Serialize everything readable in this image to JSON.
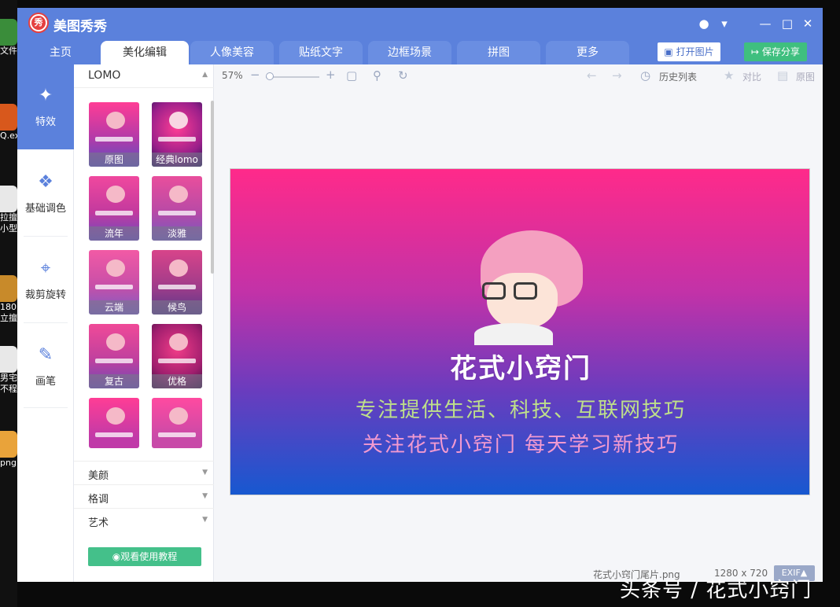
{
  "app": {
    "title": "美图秀秀",
    "logo_text": "秀"
  },
  "desktop": {
    "labels": [
      "文件",
      "Q.exe",
      "拉擅",
      "小型",
      "180",
      "立擅",
      "男宅",
      "不程",
      "png"
    ]
  },
  "titlebar_controls": [
    "comment-icon",
    "dropdown-icon",
    "minimize-icon",
    "maximize-icon",
    "close-icon"
  ],
  "tabs": [
    {
      "label": "主页",
      "active": false
    },
    {
      "label": "美化编辑",
      "active": true
    },
    {
      "label": "人像美容",
      "active": false
    },
    {
      "label": "贴纸文字",
      "active": false
    },
    {
      "label": "边框场景",
      "active": false
    },
    {
      "label": "拼图",
      "active": false
    },
    {
      "label": "更多",
      "active": false
    }
  ],
  "header_buttons": {
    "open": "打开图片",
    "save": "保存分享"
  },
  "nav": [
    {
      "label": "特效",
      "icon": "magic-wand-icon",
      "selected": true
    },
    {
      "label": "基础调色",
      "icon": "palette-icon",
      "selected": false
    },
    {
      "label": "裁剪旋转",
      "icon": "crop-icon",
      "selected": false
    },
    {
      "label": "画笔",
      "icon": "brush-icon",
      "selected": false
    }
  ],
  "panel": {
    "section": "LOMO",
    "effects": [
      "原图",
      "经典lomo",
      "流年",
      "淡雅",
      "云端",
      "候鸟",
      "复古",
      "优格",
      "",
      ""
    ],
    "accordions": [
      "美颜",
      "格调",
      "艺术"
    ],
    "tutorial_button": "观看使用教程"
  },
  "toolbar": {
    "zoom": "57%",
    "zoom_level": 0.57,
    "history": "历史列表",
    "compare": "对比",
    "original": "原图"
  },
  "photo": {
    "title": "花式小窍门",
    "line1": "专注提供生活、科技、互联网技巧",
    "line2": "关注花式小窍门 每天学习新技巧"
  },
  "status": {
    "filename": "花式小窍门尾片.png",
    "dimensions": "1280 x 720",
    "exif": "EXIF▲"
  },
  "watermark": "头条号 / 花式小窍门",
  "colors": {
    "accent": "#5b81dc",
    "save_green": "#3fbf7f",
    "tutorial_green": "#44c08a"
  }
}
